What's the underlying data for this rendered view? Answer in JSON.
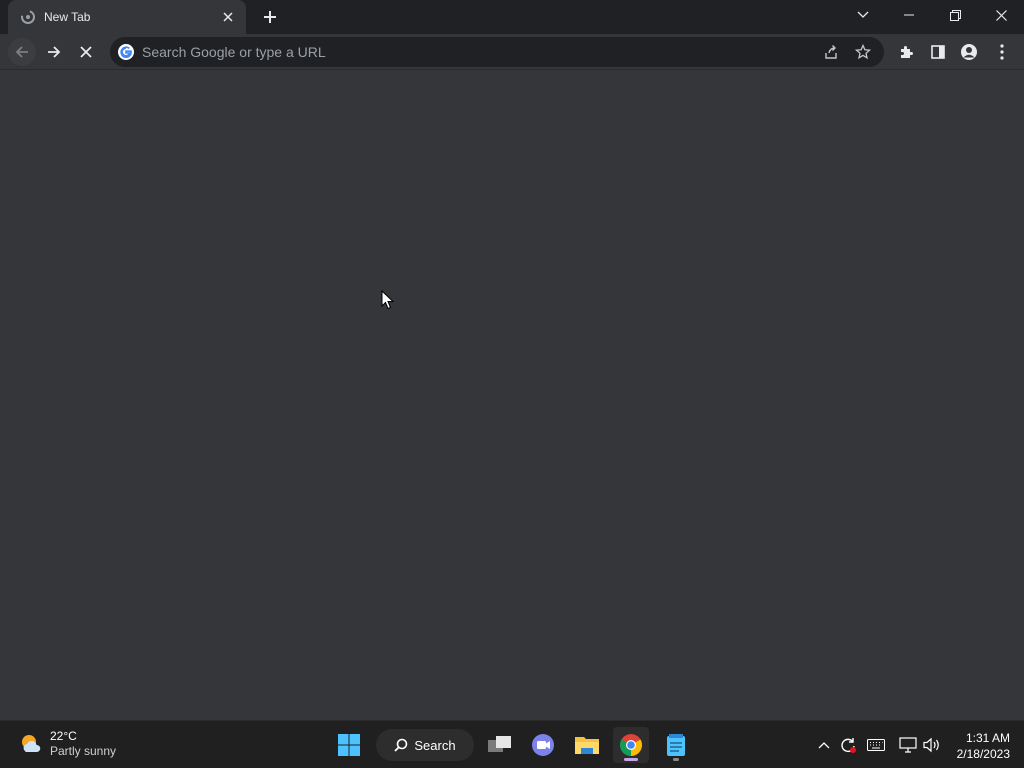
{
  "browser": {
    "tab": {
      "title": "New Tab"
    },
    "omnibox": {
      "placeholder": "Search Google or type a URL"
    }
  },
  "taskbar": {
    "weather": {
      "temp": "22°C",
      "condition": "Partly sunny"
    },
    "search_label": "Search",
    "clock": {
      "time": "1:31 AM",
      "date": "2/18/2023"
    }
  },
  "colors": {
    "titlebar": "#202124",
    "toolbar": "#35363a",
    "content": "#35363a",
    "taskbar": "#202020",
    "accent": "#8ab4f8"
  }
}
